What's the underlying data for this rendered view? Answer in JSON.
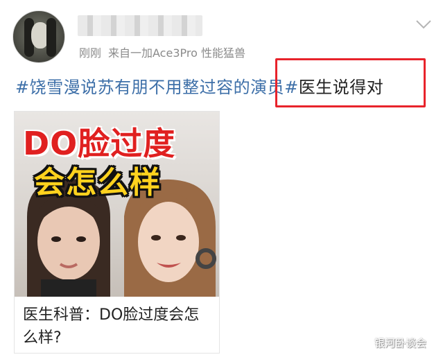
{
  "post": {
    "author": {
      "avatar_icon": "avatar-photo-icon",
      "name_hidden": "blurred-username"
    },
    "meta": {
      "time": "刚刚",
      "source": "来自一加Ace3Pro 性能猛兽"
    },
    "more_icon": "chevron-down-icon",
    "text": {
      "topic": "#饶雪漫说苏有朋不用整过容的演员",
      "hashtag_mark": "#",
      "highlighted": "医生说得对"
    },
    "highlight_color": "#e8232b",
    "topic_color": "#3d6fa8",
    "card": {
      "image_title_line1": "DO脸过度",
      "image_title_line2": "会怎么样",
      "caption": "医生科普：DO脸过度会怎么样?"
    }
  },
  "watermark": "银河卧谈会"
}
